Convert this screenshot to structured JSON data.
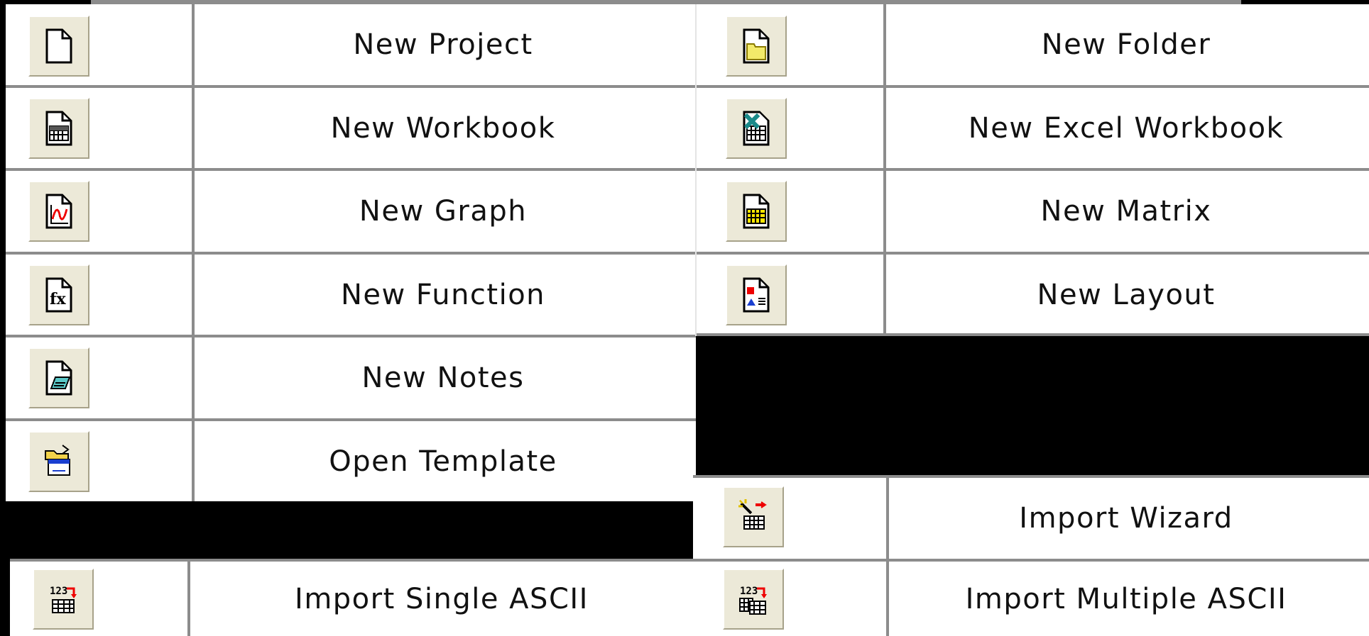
{
  "buttons": {
    "new_project": "New Project",
    "new_folder": "New Folder",
    "new_workbook": "New Workbook",
    "new_excel_workbook": "New Excel Workbook",
    "new_graph": "New Graph",
    "new_matrix": "New Matrix",
    "new_function": "New Function",
    "new_layout": "New Layout",
    "new_notes": "New Notes",
    "open_template": "Open Template",
    "import_wizard": "Import Wizard",
    "import_single_ascii": "Import Single ASCII",
    "import_multiple_ascii": "Import Multiple ASCII"
  },
  "icons": {
    "new_project": "blank-document-icon",
    "new_folder": "new-folder-icon",
    "new_workbook": "workbook-grid-icon",
    "new_excel_workbook": "excel-workbook-icon",
    "new_graph": "graph-icon",
    "new_matrix": "matrix-icon",
    "new_function": "function-fx-icon",
    "new_layout": "layout-page-icon",
    "new_notes": "notes-icon",
    "open_template": "open-template-icon",
    "import_wizard": "import-wizard-icon",
    "import_single_ascii": "import-single-ascii-icon",
    "import_multiple_ascii": "import-multiple-ascii-icon"
  },
  "colors": {
    "icon_face": "#ece9d8",
    "grid_line": "#8c8c8c",
    "background": "#ffffff",
    "masked_region": "#000000"
  }
}
